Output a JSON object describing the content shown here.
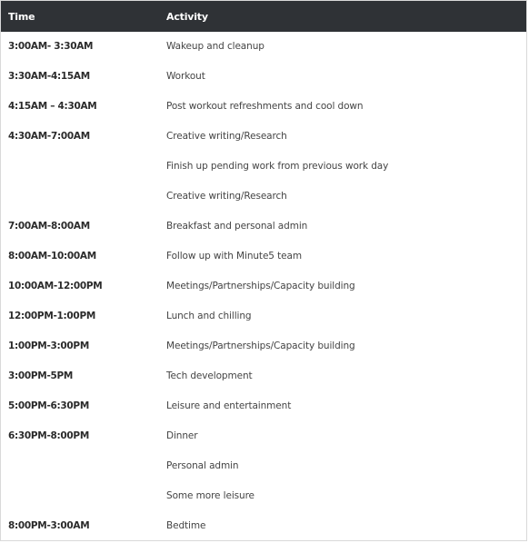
{
  "header": {
    "time_label": "Time",
    "activity_label": "Activity"
  },
  "rows": [
    {
      "time": "3:00AM- 3:30AM",
      "activity": "Wakeup and cleanup"
    },
    {
      "time": "3:30AM-4:15AM",
      "activity": "Workout"
    },
    {
      "time": "4:15AM – 4:30AM",
      "activity": "Post workout refreshments and cool down"
    },
    {
      "time": "4:30AM-7:00AM",
      "activity": "Creative writing/Research"
    },
    {
      "time": "",
      "activity": "Finish up pending work from previous work day"
    },
    {
      "time": "",
      "activity": "Creative writing/Research"
    },
    {
      "time": "7:00AM-8:00AM",
      "activity": "Breakfast and personal admin"
    },
    {
      "time": "8:00AM-10:00AM",
      "activity": "Follow up with Minute5 team"
    },
    {
      "time": "10:00AM-12:00PM",
      "activity": "Meetings/Partnerships/Capacity building"
    },
    {
      "time": "12:00PM-1:00PM",
      "activity": "Lunch and chilling"
    },
    {
      "time": "1:00PM-3:00PM",
      "activity": "Meetings/Partnerships/Capacity building"
    },
    {
      "time": "3:00PM-5PM",
      "activity": "Tech development"
    },
    {
      "time": "5:00PM-6:30PM",
      "activity": "Leisure and entertainment"
    },
    {
      "time": "6:30PM-8:00PM",
      "activity": "Dinner"
    },
    {
      "time": "",
      "activity": "Personal admin"
    },
    {
      "time": "",
      "activity": "Some more leisure"
    },
    {
      "time": "8:00PM-3:00AM",
      "activity": "Bedtime"
    }
  ]
}
